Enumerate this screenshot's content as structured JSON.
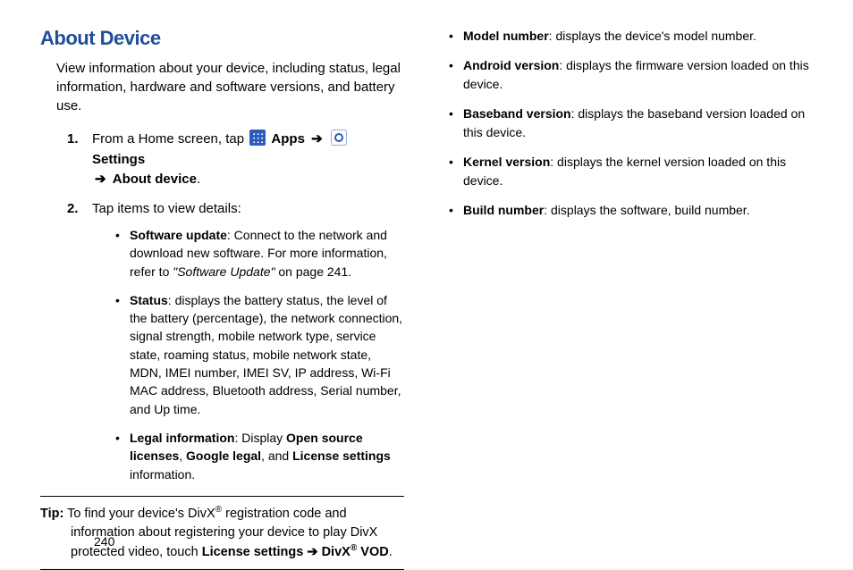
{
  "title": "About Device",
  "intro": "View information about your device, including status, legal information, hardware and software versions, and battery use.",
  "step1": {
    "num": "1.",
    "prefix": "From a Home screen, tap ",
    "apps_label": "Apps",
    "arrow": "➔",
    "settings_label": "Settings",
    "about_device": "About device",
    "period": "."
  },
  "step2": {
    "num": "2.",
    "text": "Tap items to view details:"
  },
  "bullets": {
    "software_update": {
      "term": "Software update",
      "text1": ": Connect to the network and download new software. For more information, refer to ",
      "ref": "\"Software Update\"",
      "text2": " on page 241."
    },
    "status": {
      "term": "Status",
      "text": ": displays the battery status, the level of the battery (percentage), the network connection, signal strength, mobile network type, service state, roaming status, mobile network state, MDN, IMEI number, IMEI SV, IP address, Wi-Fi MAC address, Bluetooth address, Serial number, and Up time."
    },
    "legal": {
      "term": "Legal information",
      "text1": ": Display ",
      "b1": "Open source licenses",
      "sep1": ", ",
      "b2": "Google legal",
      "sep2": ", and ",
      "b3": "License settings",
      "text2": " information."
    }
  },
  "tip": {
    "label": "Tip:",
    "text1": " To find your device's DivX",
    "reg": "®",
    "text2": " registration code and information about registering your device to play DivX protected video, touch ",
    "b1": "License settings",
    "arrow": " ➔ ",
    "b2": "DivX",
    "b3": " VOD",
    "end": "."
  },
  "right": {
    "model": {
      "term": "Model number",
      "text": ": displays the device's model number."
    },
    "android": {
      "term": "Android version",
      "text": ": displays the firmware version loaded on this device."
    },
    "baseband": {
      "term": "Baseband version",
      "text": ": displays the baseband version loaded on this device."
    },
    "kernel": {
      "term": "Kernel version",
      "text": ": displays the kernel version loaded on this device."
    },
    "build": {
      "term": "Build number",
      "text": ": displays the software, build number."
    }
  },
  "page_number": "240"
}
